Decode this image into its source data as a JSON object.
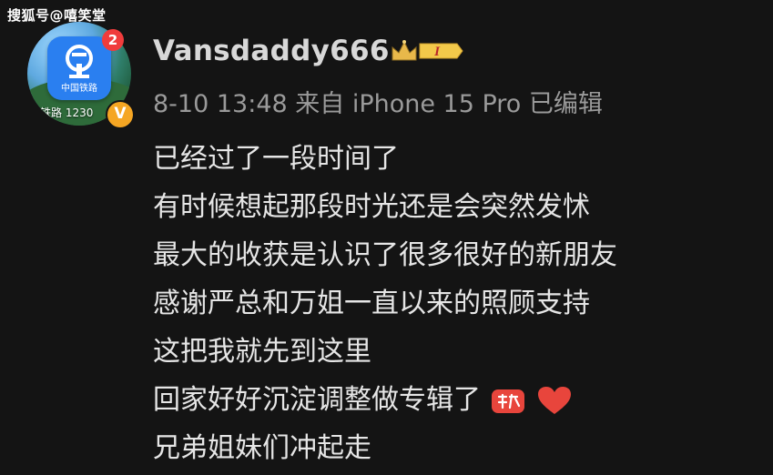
{
  "watermark": "搜狐号@嘻笑堂",
  "avatar": {
    "notification_count": "2",
    "app_icon_caption": "中国铁路",
    "tag_text": "铁路 1230",
    "verified_mark": "V",
    "verified_color": "#f5a623",
    "app_icon_color": "#2a7ff0",
    "badge_color": "#f03c3c"
  },
  "user": {
    "name": "Vansdaddy666",
    "level_label": "I"
  },
  "meta": {
    "text": "8-10 13:48  来自 iPhone 15 Pro 已编辑"
  },
  "post": {
    "lines": [
      "已经过了一段时间了",
      "有时候想起那段时光还是会突然发怵",
      "最大的收获是认识了很多很好的新朋友",
      "感谢严总和万姐一直以来的照顾支持",
      "这把我就先到这里",
      "回家好好沉淀调整做专辑了",
      "兄弟姐妹们冲起走"
    ],
    "emojis": [
      "fist-emoji",
      "red-heart-emoji"
    ]
  }
}
